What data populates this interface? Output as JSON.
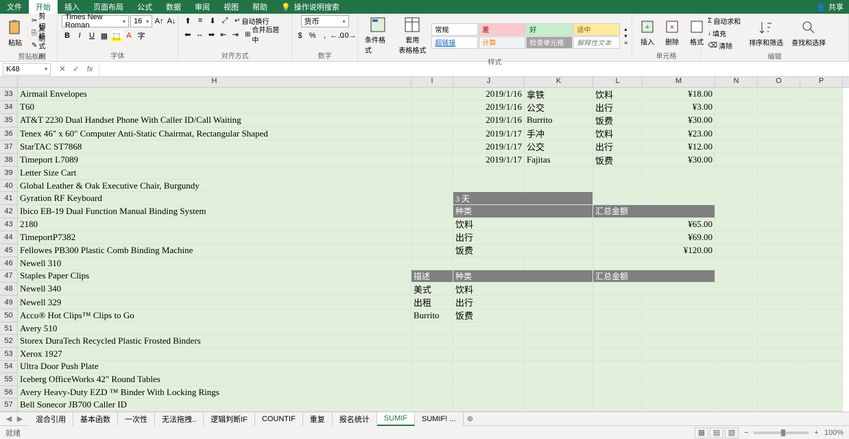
{
  "tabs": {
    "file": "文件",
    "home": "开始",
    "insert": "插入",
    "layout": "页面布局",
    "formulas": "公式",
    "data": "数据",
    "review": "审阅",
    "view": "视图",
    "help": "帮助",
    "tell": "操作说明搜索",
    "share": "共享"
  },
  "ribbon": {
    "clipboard": {
      "paste": "粘贴",
      "cut": "剪切",
      "copy": "复制",
      "painter": "格式刷",
      "label": "剪贴板"
    },
    "font": {
      "name": "Times New Roman",
      "size": "16",
      "label": "字体"
    },
    "align": {
      "wrap": "自动换行",
      "merge": "合并后居中",
      "label": "对齐方式"
    },
    "number": {
      "format": "货币",
      "label": "数字"
    },
    "styles": {
      "condfmt": "条件格式",
      "tableformat": "套用\n表格格式",
      "normal": "常规",
      "bad": "差",
      "good": "好",
      "neutral": "适中",
      "link": "超链接",
      "calc": "计算",
      "check": "检查单元格",
      "explain": "解释性文本",
      "label": "样式"
    },
    "cells": {
      "insert": "插入",
      "delete": "删除",
      "format": "格式",
      "label": "单元格"
    },
    "editing": {
      "autosum": "自动求和",
      "fill": "填充",
      "clear": "清除",
      "sort": "排序和筛选",
      "find": "查找和选择",
      "label": "编辑"
    }
  },
  "namebox": "K48",
  "columns": [
    "H",
    "I",
    "J",
    "K",
    "L",
    "M",
    "N",
    "O",
    "P"
  ],
  "rows": [
    {
      "n": 33,
      "h": "Airmail Envelopes",
      "j": "2019/1/16",
      "k": "拿铁",
      "l": "饮料",
      "m": "¥18.00"
    },
    {
      "n": 34,
      "h": "T60",
      "j": "2019/1/16",
      "k": "公交",
      "l": "出行",
      "m": "¥3.00"
    },
    {
      "n": 35,
      "h": "AT&T 2230 Dual Handset Phone With Caller ID/Call Waiting",
      "j": "2019/1/16",
      "k": "Burrito",
      "l": "饭费",
      "m": "¥30.00"
    },
    {
      "n": 36,
      "h": "Tenex 46\" x 60\" Computer Anti-Static Chairmat, Rectangular Shaped",
      "j": "2019/1/17",
      "k": "手冲",
      "l": "饮料",
      "m": "¥23.00"
    },
    {
      "n": 37,
      "h": "StarTAC ST7868",
      "j": "2019/1/17",
      "k": "公交",
      "l": "出行",
      "m": "¥12.00"
    },
    {
      "n": 38,
      "h": "Timeport L7089",
      "j": "2019/1/17",
      "k": "Fajitas",
      "l": "饭费",
      "m": "¥30.00"
    },
    {
      "n": 39,
      "h": "Letter Size Cart"
    },
    {
      "n": 40,
      "h": "Global Leather & Oak Executive Chair, Burgundy"
    },
    {
      "n": 41,
      "h": "Gyration RF Keyboard",
      "jhdr": "3 天"
    },
    {
      "n": 42,
      "h": "Ibico EB-19 Dual Function Manual Binding System",
      "jkhdr": "种类",
      "lmhdr": "汇总金额"
    },
    {
      "n": 43,
      "h": "2180",
      "jk": "饮料",
      "lm": "¥65.00"
    },
    {
      "n": 44,
      "h": "TimeportP7382",
      "jk": "出行",
      "lm": "¥69.00"
    },
    {
      "n": 45,
      "h": "Fellowes PB300 Plastic Comb Binding Machine",
      "jk": "饭费",
      "lm": "¥120.00"
    },
    {
      "n": 46,
      "h": "Newell 310"
    },
    {
      "n": 47,
      "h": "Staples Paper Clips",
      "ihdr": "描述",
      "jkhdr": "种类",
      "lmhdr": "汇总金额"
    },
    {
      "n": 48,
      "h": "Newell 340",
      "i": "美式",
      "jk": "饮料"
    },
    {
      "n": 49,
      "h": "Newell 329",
      "i": "出租",
      "jk": "出行"
    },
    {
      "n": 50,
      "h": "Acco® Hot Clips™ Clips to Go",
      "i": "Burrito",
      "jk": "饭费"
    },
    {
      "n": 51,
      "h": "Avery 510"
    },
    {
      "n": 52,
      "h": "Storex DuraTech Recycled Plastic Frosted Binders"
    },
    {
      "n": 53,
      "h": "Xerox 1927"
    },
    {
      "n": 54,
      "h": "Ultra Door Push Plate"
    },
    {
      "n": 55,
      "h": "Iceberg OfficeWorks 42\" Round Tables"
    },
    {
      "n": 56,
      "h": "Avery Heavy-Duty EZD ™ Binder With Locking Rings"
    },
    {
      "n": 57,
      "h": "Bell Sonecor JB700 Caller ID"
    }
  ],
  "sheets": [
    "混合引用",
    "基本函数",
    "一次性",
    "无法拖拽..",
    "逻辑判断IF",
    "COUNTIF",
    "重复",
    "报名统计",
    "SUMIF",
    "SUMIF! ..."
  ],
  "activeSheet": "SUMIF",
  "status": {
    "ready": "就绪",
    "zoom": "100%"
  }
}
